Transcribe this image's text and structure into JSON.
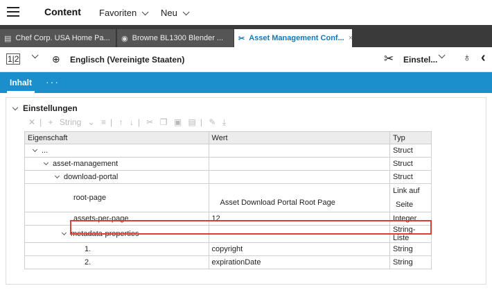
{
  "topbar": {
    "content_label": "Content",
    "favoriten_label": "Favoriten",
    "neu_label": "Neu"
  },
  "tabs": [
    {
      "label": "Chef Corp. USA Home Pa...",
      "icon": "page-icon"
    },
    {
      "label": "Browne BL1300 Blender ...",
      "icon": "product-icon"
    },
    {
      "label": "Asset Management Conf...",
      "icon": "tools-icon",
      "close": "×"
    }
  ],
  "toolbar": {
    "view_icon_text": "1|2",
    "language": "Englisch (Vereinigte Staaten)",
    "settings_label": "Einstel..."
  },
  "bluebar": {
    "tab_label": "Inhalt",
    "more": "···"
  },
  "section": {
    "title": "Einstellungen",
    "toolbar_string": "String"
  },
  "table": {
    "headers": [
      "Eigenschaft",
      "Wert",
      "Typ"
    ],
    "rows": [
      {
        "prop": "...",
        "wert": "",
        "typ": "Struct"
      },
      {
        "prop": "asset-management",
        "wert": "",
        "typ": "Struct"
      },
      {
        "prop": "download-portal",
        "wert": "",
        "typ": "Struct"
      },
      {
        "prop": "root-page",
        "wert": "Asset Download Portal Root Page",
        "typ_line1": "Link auf",
        "typ_line2": "Seite"
      },
      {
        "prop": "assets-per-page",
        "wert": "12",
        "typ": "Integer"
      },
      {
        "prop": "metadata-properties",
        "wert": "",
        "typ": "String-Liste"
      },
      {
        "prop": "1.",
        "wert": "copyright",
        "typ": "String"
      },
      {
        "prop": "2.",
        "wert": "expirationDate",
        "typ": "String"
      }
    ]
  },
  "colors": {
    "accent_blue": "#1a8fcb",
    "tab_bar": "#3a3a3a",
    "highlight_red": "#e03a3a"
  }
}
